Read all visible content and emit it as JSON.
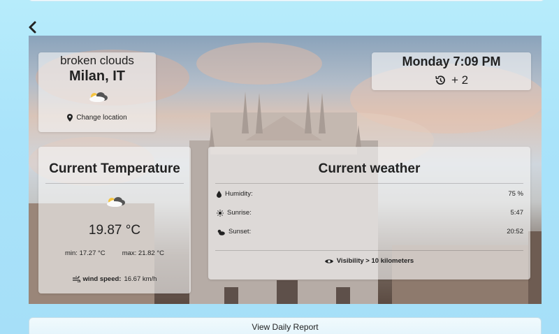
{
  "location": {
    "description": "broken clouds",
    "city": "Milan, IT",
    "weather_icon": "cloud-sun-icon",
    "change_label": "Change location"
  },
  "time": {
    "day_time": "Monday 7:09 PM",
    "tz_offset": "+ 2"
  },
  "temperature": {
    "title": "Current Temperature",
    "value": "19.87 °C",
    "min": "min: 17.27 °C",
    "max": "max: 21.82 °C",
    "wind_label": "wind speed:",
    "wind_value": "16.67 km/h"
  },
  "weather": {
    "title": "Current weather",
    "rows": [
      {
        "label": "Humidity:",
        "value": "75 %",
        "icon": "droplet-icon"
      },
      {
        "label": "Sunrise:",
        "value": "5:47",
        "icon": "sun-icon"
      },
      {
        "label": "Sunset:",
        "value": "20:52",
        "icon": "cloud-sun-icon"
      }
    ],
    "visibility": "Visibility > 10 kilometers"
  },
  "footer": {
    "daily_report_label": "View Daily Report"
  }
}
